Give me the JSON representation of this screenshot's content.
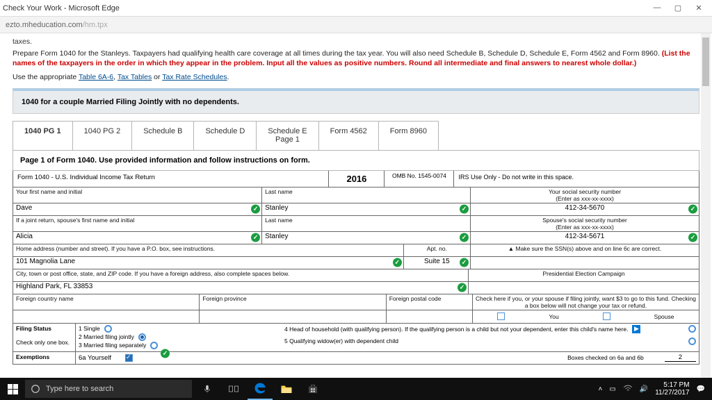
{
  "window": {
    "title": "Check Your Work - Microsoft Edge"
  },
  "url": {
    "host": "ezto.mheducation.com",
    "path": "/hm.tpx"
  },
  "intro": {
    "taxes": "taxes.",
    "line1": "Prepare Form 1040 for the Stanleys. Taxpayers had qualifying health care coverage at all times during the tax year. You will also need Schedule B, Schedule D, Schedule E, Form 4562 and Form 8960.",
    "red": "(List the names of the taxpayers in the order in which they appear in the problem. Input all the values as positive numbers. Round all intermediate and final answers to nearest whole dollar.)",
    "use": "Use the appropriate ",
    "link1": "Table 6A-6",
    "sep1": ", ",
    "link2": "Tax Tables",
    "sep2": " or ",
    "link3": "Tax Rate Schedules",
    "end": "."
  },
  "banner": "1040 for a couple Married Filing Jointly with no dependents.",
  "tabs": [
    "1040 PG 1",
    "1040 PG 2",
    "Schedule B",
    "Schedule D",
    "Schedule E\nPage 1",
    "Form 4562",
    "Form 8960"
  ],
  "pagetitle": "Page 1 of Form 1040.  Use provided information and follow instructions on form.",
  "form": {
    "title": "Form 1040 - U.S. Individual Income Tax Return",
    "year": "2016",
    "omb": "OMB No. 1545-0074",
    "irsuse": "IRS Use Only - Do not write in this space.",
    "l_first": "Your first name and initial",
    "l_last": "Last name",
    "l_ssn": "Your social security number",
    "ssn_hint": "(Enter as xxx-xx-xxxx)",
    "first1": "Dave",
    "last1": "Stanley",
    "ssn1": "412-34-5670",
    "l_jfirst": "If a joint return, spouse's first name and initial",
    "l_sssn": "Spouse's social security number",
    "first2": "Alicia",
    "last2": "Stanley",
    "ssn2": "412-34-5671",
    "l_addr": "Home address (number and street).  If you have a P.O. box, see instructions.",
    "l_apt": "Apt. no.",
    "addr": "101 Magnolia Lane",
    "apt": "Suite 15",
    "ssnnote": "▲ Make sure the SSN(s) above and on line 6c are correct.",
    "l_city": "City, town or post office, state, and ZIP code.  If you have a foreign address, also complete spaces below.",
    "city": "Highland Park, FL 33853",
    "pres": "Presidential Election Campaign",
    "l_fcountry": "Foreign country name",
    "l_fprov": "Foreign province",
    "l_fpost": "Foreign postal code",
    "presnote": "Check here if you, or your spouse if filing jointly, want $3 to go to this fund. Checking a box below will not change your tax or refund.",
    "you": "You",
    "spouse": "Spouse"
  },
  "filing": {
    "title": "Filing Status",
    "checkone": "Check only one box.",
    "s1": "1  Single",
    "s2": "2  Married filing jointly",
    "s3": "3  Married filing separately",
    "s4": "4  Head of household (with qualifying person).  If the qualifying person is a child but not your dependent, enter this child's name here.",
    "s5": "5  Qualifying widow(er) with dependent child",
    "exemptions": "Exemptions",
    "e6a": "6a  Yourself",
    "boxes": "Boxes checked on 6a and 6b",
    "two": "2"
  },
  "taskbar": {
    "search": "Type here to search",
    "time": "5:17 PM",
    "date": "11/27/2017"
  }
}
